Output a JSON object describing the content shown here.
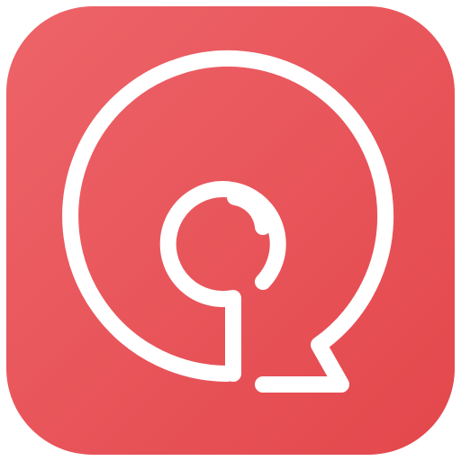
{
  "icon": {
    "name": "app-icon",
    "glyph": "pin-in-speech-bubble-icon",
    "colors": {
      "background_top": "#ED6469",
      "background_bottom": "#E3474C",
      "stroke": "#FFFFFF"
    }
  }
}
